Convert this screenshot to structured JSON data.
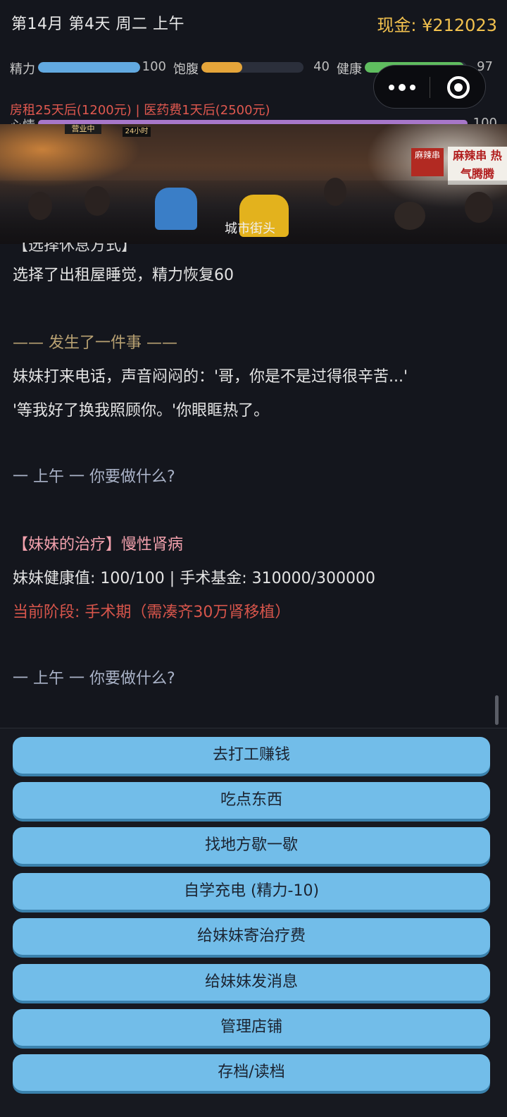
{
  "header": {
    "date": "第14月 第4天 周二 上午",
    "cash": "现金: ¥212023"
  },
  "stats": [
    {
      "label": "精力",
      "value": "100",
      "fill_fraction": 1.0,
      "color": "#62a9e0"
    },
    {
      "label": "饱腹",
      "value": "40",
      "fill_fraction": 0.4,
      "color": "#e5a53a"
    },
    {
      "label": "健康",
      "value": "97",
      "fill_fraction": 0.97,
      "color": "#5fbd5f"
    }
  ],
  "bills": "房租25天后(1200元)  |  医药费1天后(2500元)",
  "mood": {
    "label": "心情",
    "value": "100",
    "color": "#a777c9"
  },
  "scene": {
    "caption": "城市街头",
    "signs": [
      "营业中",
      "24小时",
      "麻辣串",
      "麻辣串 热气腾腾"
    ]
  },
  "log": {
    "clipped_heading": "【选择休息方式】",
    "lines": [
      "选择了出租屋睡觉，精力恢复60",
      "—— 发生了一件事 ——",
      "妹妹打来电话，声音闷闷的：'哥，你是不是过得很辛苦...'",
      "'等我好了换我照顾你。'你眼眶热了。",
      "一 上午 一  你要做什么?",
      "【妹妹的治疗】慢性肾病",
      "妹妹健康值: 100/100 | 手术基金: 310000/300000",
      "当前阶段: 手术期（需凑齐30万肾移植）",
      "一 上午 一  你要做什么?"
    ]
  },
  "actions": [
    "去打工赚钱",
    "吃点东西",
    "找地方歇一歇",
    "自学充电 (精力-10)",
    "给妹妹寄治疗费",
    "给妹妹发消息",
    "管理店铺",
    "存档/读档"
  ],
  "colors": {
    "accent_gold": "#f2c14e",
    "button_blue": "#72bde9",
    "warning_red": "#e0584f"
  }
}
